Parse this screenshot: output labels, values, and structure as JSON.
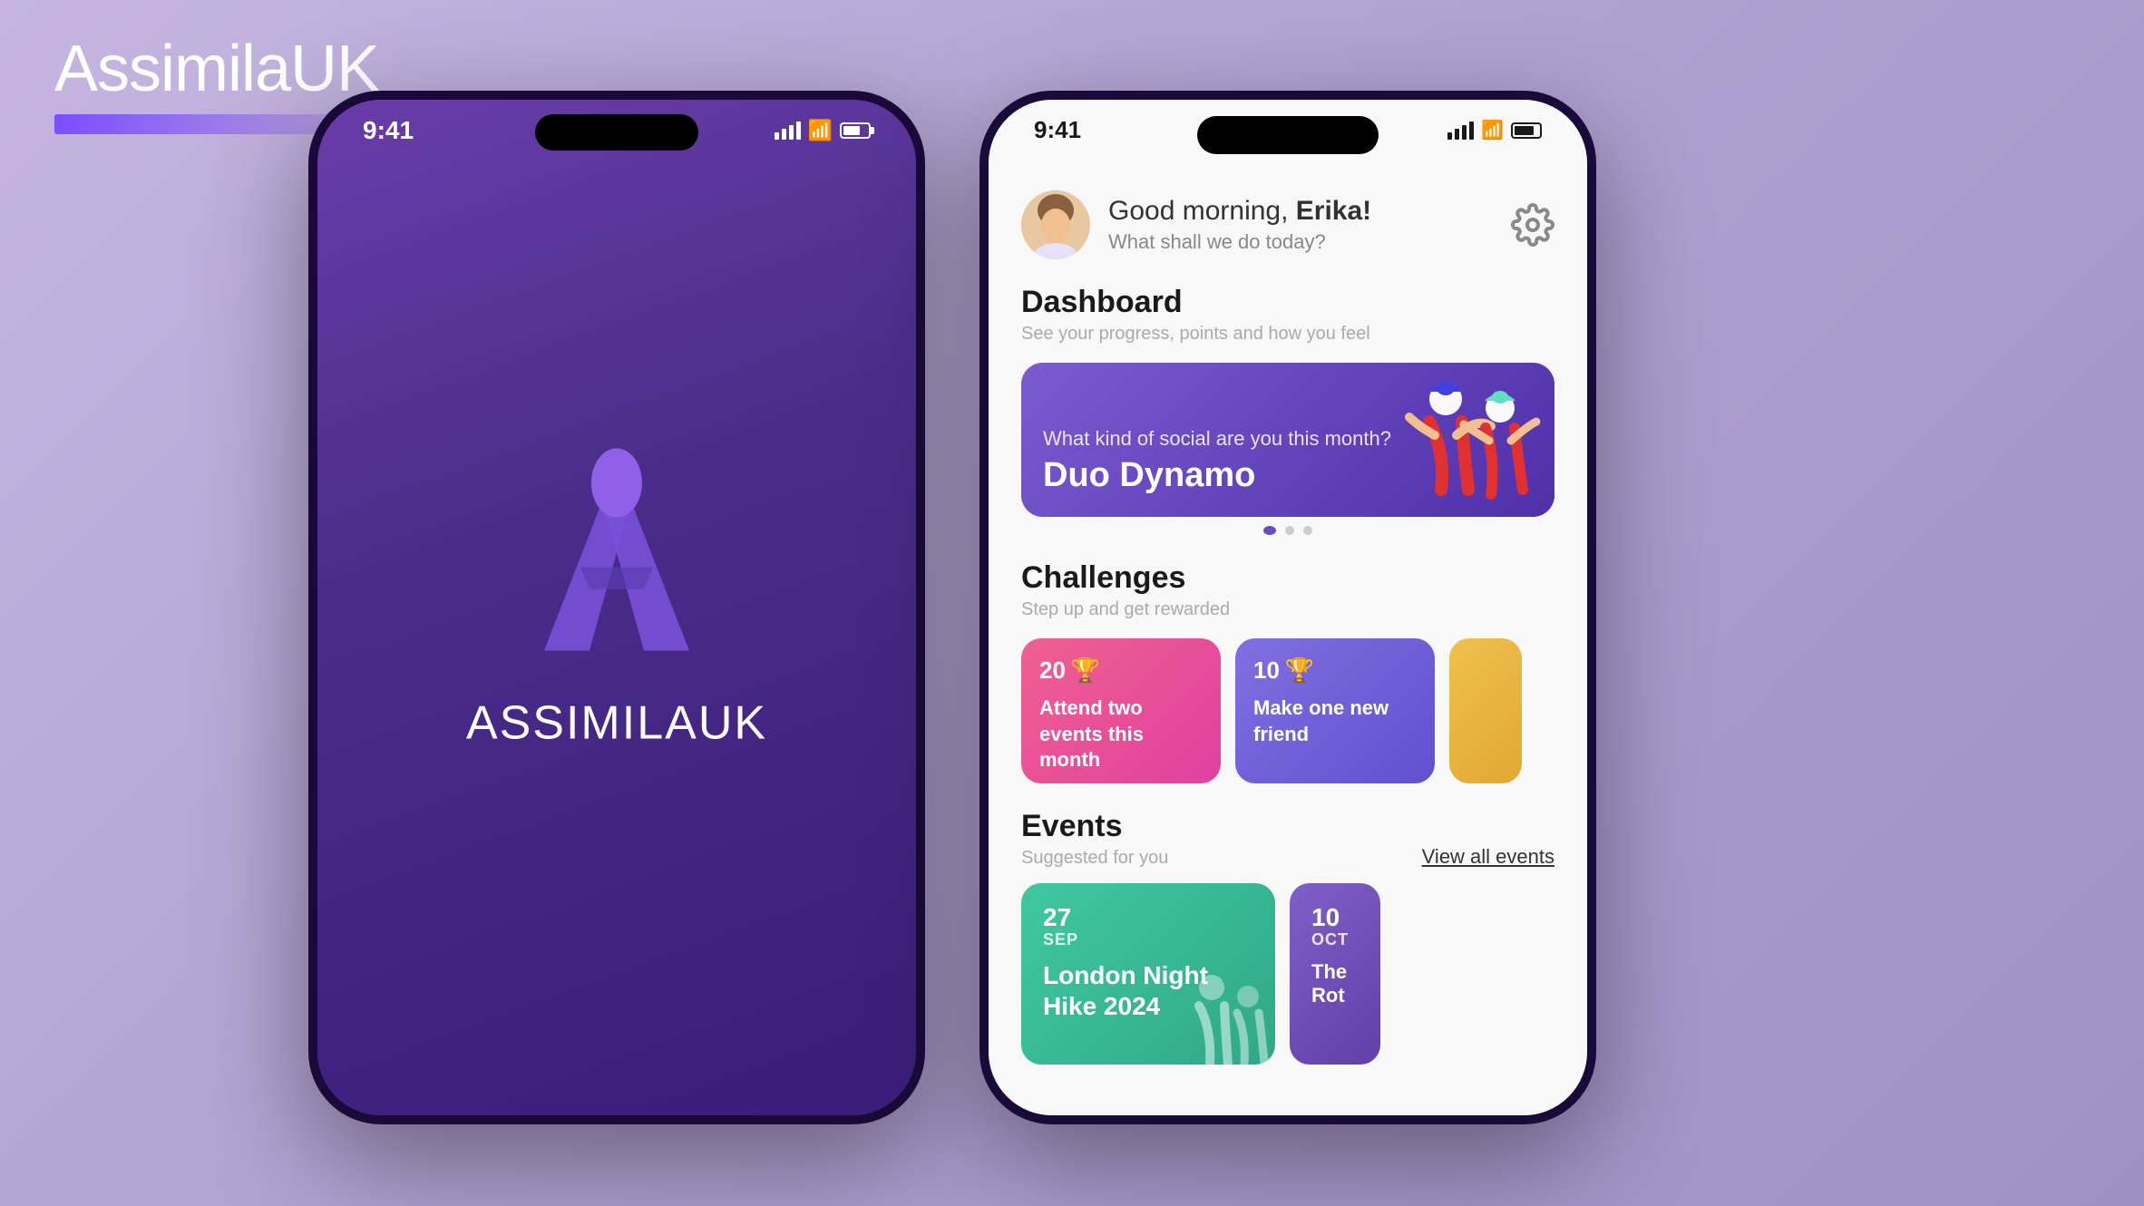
{
  "brand": {
    "name_bold": "Assimila",
    "name_regular": "UK"
  },
  "logo": {
    "text_bold": "ASSIMILA",
    "text_regular": "UK"
  },
  "left_phone": {
    "status_time": "9:41"
  },
  "right_phone": {
    "status_time": "9:41",
    "greeting": "Good morning, ",
    "user_name": "Erika!",
    "greeting_sub": "What shall we do today?",
    "dashboard_section_title": "Dashboard",
    "dashboard_section_sub": "See your progress, points and how you feel",
    "banner_question": "What kind of social are you this month?",
    "banner_answer": "Duo Dynamo",
    "challenges_section_title": "Challenges",
    "challenges_section_sub": "Step up and get rewarded",
    "challenges": [
      {
        "points": "20",
        "trophy": "🏆",
        "label": "Attend two events this month",
        "color": "pink"
      },
      {
        "points": "10",
        "trophy": "🏆",
        "label": "Make one new friend",
        "color": "purple"
      },
      {
        "points": "",
        "trophy": "",
        "label": "",
        "color": "yellow"
      }
    ],
    "events_section_title": "Events",
    "events_section_sub": "Suggested for you",
    "view_all_label": "View all events",
    "events": [
      {
        "day": "27",
        "month": "SEP",
        "title": "London Night Hike 2024",
        "color": "teal"
      },
      {
        "day": "10",
        "month": "OCT",
        "title": "The Rot",
        "color": "purple"
      }
    ],
    "carousel_dots": [
      {
        "active": true
      },
      {
        "active": false
      },
      {
        "active": false
      }
    ]
  }
}
